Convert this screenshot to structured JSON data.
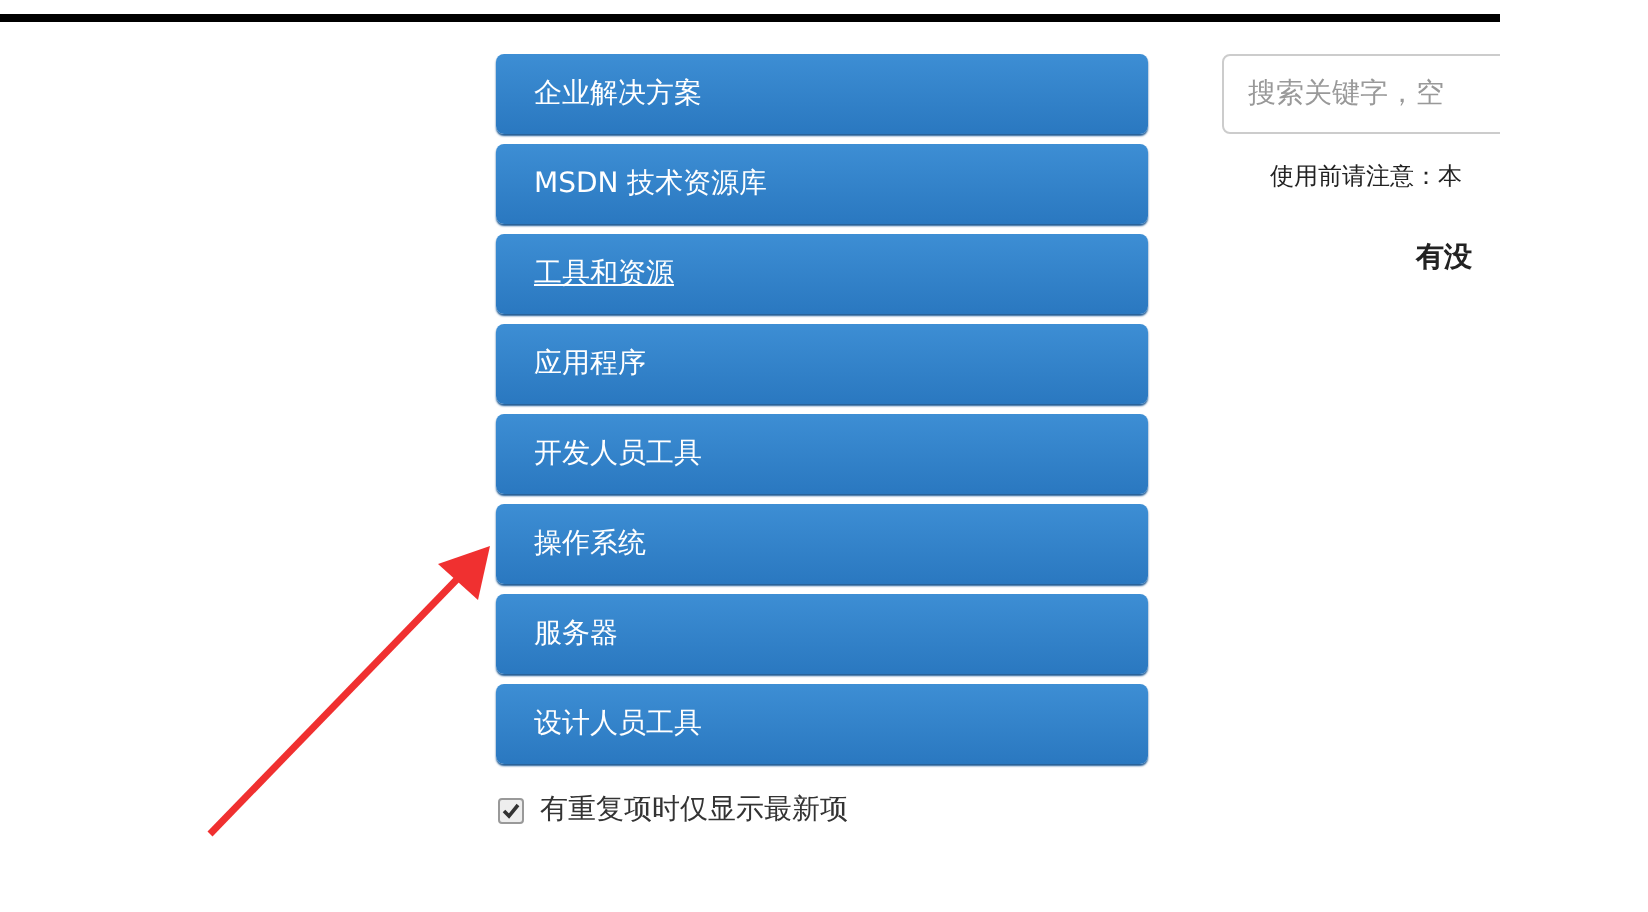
{
  "sidebar": {
    "items": [
      {
        "label": "企业解决方案",
        "hovered": false
      },
      {
        "label": "MSDN 技术资源库",
        "hovered": false
      },
      {
        "label": "工具和资源",
        "hovered": true
      },
      {
        "label": "应用程序",
        "hovered": false
      },
      {
        "label": "开发人员工具",
        "hovered": false
      },
      {
        "label": "操作系统",
        "hovered": false
      },
      {
        "label": "服务器",
        "hovered": false
      },
      {
        "label": "设计人员工具",
        "hovered": false
      }
    ]
  },
  "filter": {
    "label": "有重复项时仅显示最新项",
    "checked": true
  },
  "search": {
    "placeholder": "搜索关键字，空"
  },
  "notice": "使用前请注意：本",
  "heading": "有没"
}
